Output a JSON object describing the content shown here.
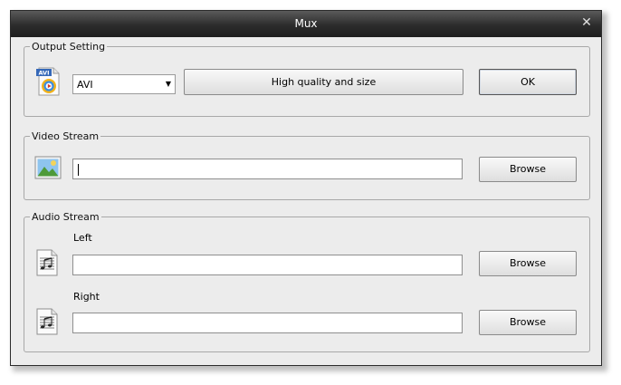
{
  "window": {
    "title": "Mux",
    "close_glyph": "✕"
  },
  "output_setting": {
    "legend": "Output Setting",
    "icon": "avi-file-icon",
    "icon_badge": "AVI",
    "format_selected": "AVI",
    "quality_button": "High quality and size",
    "ok_button": "OK"
  },
  "video_stream": {
    "legend": "Video Stream",
    "icon": "image-file-icon",
    "path_value": "",
    "browse_button": "Browse"
  },
  "audio_stream": {
    "legend": "Audio Stream",
    "left_label": "Left",
    "right_label": "Right",
    "icon": "audio-file-icon",
    "left_value": "",
    "right_value": "",
    "browse_left": "Browse",
    "browse_right": "Browse"
  }
}
